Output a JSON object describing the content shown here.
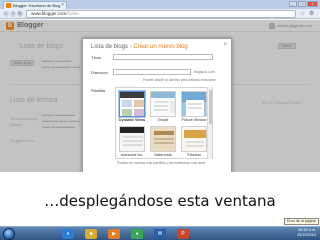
{
  "browser": {
    "tab_title": "Blogger: Escritorio de Blog",
    "tab_close": "×",
    "controls": [
      "_",
      "□",
      "×"
    ],
    "nav": {
      "back": "‹",
      "forward": "›",
      "reload": "↻"
    },
    "address_domain": "www.blogger.com",
    "address_path": "/home"
  },
  "blogger": {
    "logo_letter": "B",
    "logo_text": "Blogger",
    "user_email": "usuario@gmail.com",
    "bg_section_title": "Lista de blogs",
    "bg_section_title_2": "Lista de lectura",
    "bg_new_blog_button": "Nuevo blog",
    "bg_side_button": "Añadir",
    "bg_left_items": [
      "Todos los blogs",
      "Blogger Buzz"
    ],
    "bg_left_link": "Añadir",
    "bg_right_label": "Ver en Google Reader"
  },
  "dialog": {
    "title_part1": "Lista de blogs",
    "title_sep": "›",
    "title_part2": "Crear un nuevo blog",
    "close_icon": "×",
    "fields": {
      "title_label": "Título",
      "address_label": "Dirección",
      "address_suffix": ".blogspot.com",
      "address_hint": "Puedes añadir un dominio personalizado más tarde",
      "template_label": "Plantilla"
    },
    "templates": [
      {
        "name": "Dynamic Views",
        "selected": true
      },
      {
        "name": "Simple",
        "selected": false
      },
      {
        "name": "Picture Window",
        "selected": false
      },
      {
        "name": "Awesome Inc.",
        "selected": false
      },
      {
        "name": "Watermark",
        "selected": false
      },
      {
        "name": "Ethereal",
        "selected": false
      }
    ],
    "templates_hint": "Puedes ver muchas más plantillas y personalizarlas más tarde"
  },
  "caption": "…desplegándose esta ventana",
  "taskbar": {
    "tooltip": "Error de la página",
    "tray_time": "10:15 a.m.",
    "tray_date": "25/10/2012",
    "task_icons": [
      {
        "name": "internet-explorer-icon",
        "glyph": "e",
        "color": "#2b7bd1"
      },
      {
        "name": "folder-icon",
        "glyph": "■",
        "color": "#d9a933"
      },
      {
        "name": "media-player-icon",
        "glyph": "▶",
        "color": "#e57b22"
      },
      {
        "name": "chrome-icon",
        "glyph": "●",
        "color": "#3aa757"
      },
      {
        "name": "word-icon",
        "glyph": "W",
        "color": "#2a5ca8"
      },
      {
        "name": "powerpoint-icon",
        "glyph": "P",
        "color": "#c9462c"
      }
    ]
  },
  "colors": {
    "accent_orange": "#f57d00",
    "selection_blue": "#5b8fd6",
    "taskbar_blue": "#2e5484"
  }
}
